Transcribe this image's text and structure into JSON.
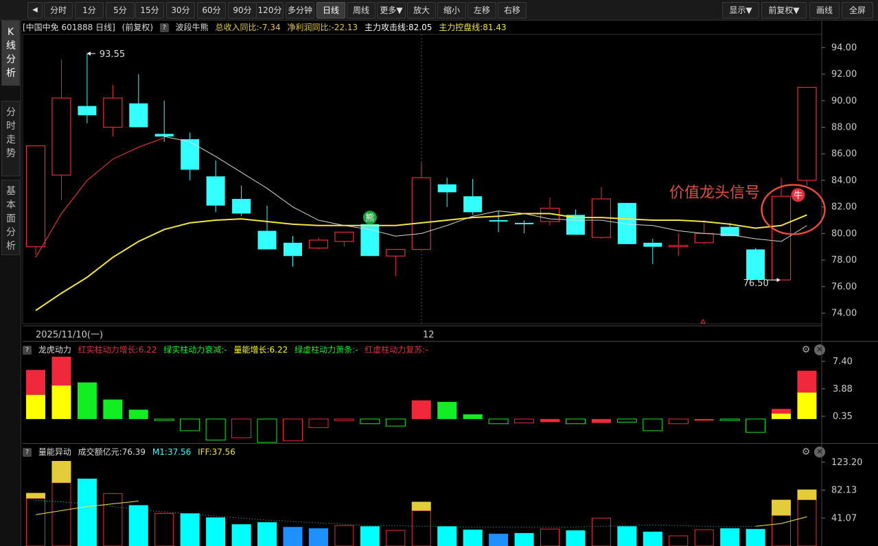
{
  "toolbar": {
    "back_icon": "back-arrow-icon",
    "items": [
      "分时",
      "1分",
      "5分",
      "15分",
      "30分",
      "60分",
      "90分",
      "120分",
      "多分钟",
      "日线",
      "周线",
      "更多▼",
      "放大",
      "缩小",
      "左移",
      "右移"
    ],
    "active": "日线",
    "right_items": [
      "显示▼",
      "前复权▼",
      "画线",
      "全屏"
    ]
  },
  "sidebar": {
    "tabs": [
      "K线分析",
      "分时走势",
      "基本面分析"
    ],
    "active": 0
  },
  "main_header": {
    "stock": "[中国中免 601888 日线]",
    "adjust": "(前复权)",
    "help": "?",
    "indicator": "波段牛熊",
    "revenue": "总收入同比:-7.34",
    "profit": "净利润同比:-22.13",
    "attack": "主力攻击线:82.05",
    "control": "主力控盘线:81.43"
  },
  "panel2_header": {
    "help": "?",
    "name": "龙虎动力",
    "f1": "红实柱动力增长:6.22",
    "f2": "绿实柱动力衰减:-",
    "f3": "量能增长:6.22",
    "f4": "绿虚柱动力萧条:-",
    "f5": "红虚柱动力复苏:-"
  },
  "panel3_header": {
    "help": "?",
    "name": "量能异动",
    "f1": "成交额亿元:76.39",
    "f2": "M1:37.56",
    "f3": "IFF:37.56"
  },
  "icons": {
    "settings": "gear-icon",
    "close": "close-icon"
  },
  "colors": {
    "up": "#f0283c",
    "down": "#33ffff",
    "ma_white": "#d8d8d8",
    "ma_red": "#e0303c",
    "ma_yellow": "#f5e642",
    "green": "#11ee22",
    "yellow_bar": "#ffff00",
    "vol_yellow": "#e3cc3a",
    "vol_cyan": "#00ffff",
    "vol_blue": "#1e90ff",
    "signal": "#e74c3c"
  },
  "signal_text": "价值龙头信号",
  "signal_badge": "牛",
  "bear_badge": "熊",
  "chart_data": [
    {
      "type": "candlestick",
      "x_labels": [
        "2025/11/10(一)",
        "12"
      ],
      "y_ticks": [
        "94.00",
        "92.00",
        "90.00",
        "88.00",
        "86.00",
        "84.00",
        "82.00",
        "80.00",
        "78.00",
        "76.00",
        "74.00"
      ],
      "ylim": [
        73.2,
        95.0
      ],
      "annotations": {
        "high": "93.55",
        "low": "76.50"
      },
      "candles": [
        {
          "o": 79.0,
          "c": 86.6,
          "h": 86.6,
          "l": 78.4,
          "up": true,
          "hollow": true
        },
        {
          "o": 84.4,
          "c": 90.2,
          "h": 93.1,
          "l": 82.5,
          "up": true,
          "hollow": true
        },
        {
          "o": 89.6,
          "c": 88.9,
          "h": 93.55,
          "l": 88.3,
          "up": false,
          "hollow": false
        },
        {
          "o": 88.0,
          "c": 90.2,
          "h": 91.2,
          "l": 87.3,
          "up": true,
          "hollow": true
        },
        {
          "o": 89.8,
          "c": 88.0,
          "h": 92.0,
          "l": 88.0,
          "up": false,
          "hollow": false
        },
        {
          "o": 87.5,
          "c": 87.3,
          "h": 90.0,
          "l": 86.9,
          "up": false,
          "hollow": false
        },
        {
          "o": 87.1,
          "c": 84.8,
          "h": 87.6,
          "l": 84.0,
          "up": false,
          "hollow": false
        },
        {
          "o": 84.3,
          "c": 82.1,
          "h": 85.5,
          "l": 81.6,
          "up": false,
          "hollow": false
        },
        {
          "o": 82.6,
          "c": 81.5,
          "h": 83.6,
          "l": 81.3,
          "up": false,
          "hollow": false
        },
        {
          "o": 80.2,
          "c": 78.8,
          "h": 82.1,
          "l": 78.8,
          "up": false,
          "hollow": false
        },
        {
          "o": 79.3,
          "c": 78.3,
          "h": 79.8,
          "l": 77.5,
          "up": false,
          "hollow": false
        },
        {
          "o": 78.9,
          "c": 79.5,
          "h": 79.7,
          "l": 78.8,
          "up": true,
          "hollow": true
        },
        {
          "o": 79.4,
          "c": 80.1,
          "h": 80.1,
          "l": 79.0,
          "up": true,
          "hollow": true
        },
        {
          "o": 80.7,
          "c": 78.3,
          "h": 80.9,
          "l": 78.3,
          "up": false,
          "hollow": false
        },
        {
          "o": 78.3,
          "c": 78.8,
          "h": 78.8,
          "l": 76.8,
          "up": true,
          "hollow": true
        },
        {
          "o": 78.8,
          "c": 84.2,
          "h": 85.4,
          "l": 78.8,
          "up": true,
          "hollow": true
        },
        {
          "o": 83.7,
          "c": 83.1,
          "h": 84.2,
          "l": 82.0,
          "up": false,
          "hollow": false
        },
        {
          "o": 82.8,
          "c": 81.6,
          "h": 84.1,
          "l": 81.4,
          "up": false,
          "hollow": false
        },
        {
          "o": 81.0,
          "c": 80.9,
          "h": 81.7,
          "l": 80.1,
          "up": false,
          "hollow": false
        },
        {
          "o": 80.8,
          "c": 80.7,
          "h": 81.0,
          "l": 80.0,
          "up": false,
          "hollow": false
        },
        {
          "o": 80.9,
          "c": 81.9,
          "h": 82.7,
          "l": 80.6,
          "up": true,
          "hollow": true
        },
        {
          "o": 81.4,
          "c": 79.9,
          "h": 81.8,
          "l": 79.9,
          "up": false,
          "hollow": false
        },
        {
          "o": 79.7,
          "c": 82.6,
          "h": 83.5,
          "l": 79.6,
          "up": true,
          "hollow": true
        },
        {
          "o": 82.3,
          "c": 79.2,
          "h": 82.3,
          "l": 79.2,
          "up": false,
          "hollow": false
        },
        {
          "o": 79.3,
          "c": 79.0,
          "h": 79.6,
          "l": 77.7,
          "up": false,
          "hollow": false
        },
        {
          "o": 79.0,
          "c": 79.1,
          "h": 80.0,
          "l": 78.3,
          "up": true,
          "hollow": true
        },
        {
          "o": 79.3,
          "c": 80.0,
          "h": 81.0,
          "l": 79.2,
          "up": true,
          "hollow": true
        },
        {
          "o": 80.5,
          "c": 79.8,
          "h": 80.8,
          "l": 79.8,
          "up": false,
          "hollow": false
        },
        {
          "o": 78.8,
          "c": 76.5,
          "h": 78.9,
          "l": 76.9,
          "up": false,
          "hollow": false
        },
        {
          "o": 76.5,
          "c": 82.8,
          "h": 84.2,
          "l": 76.5,
          "up": true,
          "hollow": true
        },
        {
          "o": 84.0,
          "c": 91.0,
          "h": 91.0,
          "l": 83.6,
          "up": true,
          "hollow": true
        }
      ],
      "ma_white": [
        null,
        null,
        null,
        null,
        null,
        87.3,
        86.9,
        85.8,
        84.6,
        83.4,
        82.0,
        81.0,
        80.6,
        80.3,
        79.8,
        80.0,
        80.6,
        81.3,
        81.7,
        81.5,
        81.1,
        81.0,
        81.0,
        80.7,
        80.6,
        80.2,
        80.0,
        79.9,
        79.6,
        79.4,
        80.6
      ],
      "ma_red": [
        78.2,
        81.5,
        84.0,
        85.6,
        86.5,
        87.2
      ],
      "ma_yellow": [
        74.2,
        75.5,
        76.7,
        78.2,
        79.4,
        80.3,
        80.8,
        81.0,
        81.1,
        80.9,
        80.7,
        80.6,
        80.6,
        80.6,
        80.6,
        80.8,
        81.0,
        81.2,
        81.3,
        81.5,
        81.5,
        81.2,
        81.2,
        81.1,
        81.0,
        81.0,
        80.9,
        80.7,
        80.4,
        80.6,
        81.4
      ]
    },
    {
      "type": "bar",
      "y_ticks": [
        "7.40",
        "3.88",
        "0.35"
      ],
      "ylim": [
        -3.0,
        8.0
      ],
      "bars": [
        {
          "style": "red_yellow",
          "yellow": 3.1,
          "top": 6.3
        },
        {
          "style": "red_yellow",
          "yellow": 4.3,
          "top": 8.0
        },
        {
          "style": "green",
          "top": 4.7
        },
        {
          "style": "green",
          "top": 2.5
        },
        {
          "style": "green",
          "top": 1.2
        },
        {
          "style": "green_hollow",
          "top": 0.0
        },
        {
          "style": "green_hollow",
          "top": -1.5
        },
        {
          "style": "green_hollow",
          "top": -2.7
        },
        {
          "style": "red_hollow",
          "top": -2.4
        },
        {
          "style": "green_hollow",
          "top": -3.0
        },
        {
          "style": "red_hollow",
          "top": -2.8
        },
        {
          "style": "red_hollow",
          "top": -1.1
        },
        {
          "style": "red_hollow",
          "top": -0.2
        },
        {
          "style": "green_hollow",
          "top": -0.6
        },
        {
          "style": "green_hollow",
          "top": -0.9
        },
        {
          "style": "red",
          "top": 2.4
        },
        {
          "style": "green",
          "top": 2.2
        },
        {
          "style": "green",
          "top": 0.6
        },
        {
          "style": "green_hollow",
          "top": -0.6
        },
        {
          "style": "red_hollow",
          "top": -0.5
        },
        {
          "style": "red",
          "top": -0.4
        },
        {
          "style": "green_hollow",
          "top": -0.6
        },
        {
          "style": "red",
          "top": -0.5
        },
        {
          "style": "green_hollow",
          "top": -0.4
        },
        {
          "style": "green_hollow",
          "top": -1.5
        },
        {
          "style": "red_hollow",
          "top": -0.6
        },
        {
          "style": "red",
          "top": -0.2
        },
        {
          "style": "green_hollow",
          "top": -0.1
        },
        {
          "style": "green_hollow",
          "top": -1.7
        },
        {
          "style": "red_yellow",
          "yellow": 0.7,
          "top": 1.3
        },
        {
          "style": "red_yellow",
          "yellow": 3.4,
          "top": 6.2
        }
      ]
    },
    {
      "type": "bar",
      "y_ticks": [
        "123.20",
        "82.13",
        "41.07"
      ],
      "ylim": [
        0,
        125
      ],
      "bars": [
        {
          "style": "red_hollow_ytop",
          "top": 70,
          "cap": 78
        },
        {
          "style": "red_hollow_ytop",
          "top": 93,
          "cap": 125
        },
        {
          "style": "cyan",
          "top": 99
        },
        {
          "style": "red_hollow",
          "top": 77
        },
        {
          "style": "cyan",
          "top": 60
        },
        {
          "style": "red_hollow",
          "top": 48
        },
        {
          "style": "cyan",
          "top": 48
        },
        {
          "style": "cyan",
          "top": 42
        },
        {
          "style": "cyan",
          "top": 32
        },
        {
          "style": "cyan",
          "top": 35
        },
        {
          "style": "blue",
          "top": 28
        },
        {
          "style": "blue",
          "top": 26
        },
        {
          "style": "red_hollow",
          "top": 30
        },
        {
          "style": "cyan",
          "top": 29
        },
        {
          "style": "red_hollow",
          "top": 23
        },
        {
          "style": "red_hollow_ytop",
          "top": 52,
          "cap": 65
        },
        {
          "style": "cyan",
          "top": 29
        },
        {
          "style": "cyan",
          "top": 24
        },
        {
          "style": "blue",
          "top": 18
        },
        {
          "style": "cyan",
          "top": 19
        },
        {
          "style": "red_hollow",
          "top": 25
        },
        {
          "style": "cyan",
          "top": 23
        },
        {
          "style": "red_hollow",
          "top": 41
        },
        {
          "style": "cyan",
          "top": 29
        },
        {
          "style": "cyan",
          "top": 21
        },
        {
          "style": "red_hollow",
          "top": 15
        },
        {
          "style": "red_hollow",
          "top": 24
        },
        {
          "style": "cyan",
          "top": 26
        },
        {
          "style": "cyan",
          "top": 25
        },
        {
          "style": "red_hollow_ytop",
          "top": 45,
          "cap": 68
        },
        {
          "style": "red_hollow_ytop",
          "top": 68,
          "cap": 83
        }
      ],
      "m1_yellow": [
        46,
        52,
        58,
        62,
        66
      ],
      "m1_dotted": [
        67,
        65,
        62,
        58,
        54,
        50,
        47,
        44,
        41,
        38,
        36,
        34,
        32,
        30,
        30,
        29,
        28,
        28,
        28,
        28,
        28,
        28,
        29,
        30,
        31,
        30,
        29,
        28,
        29,
        33,
        43
      ]
    }
  ]
}
